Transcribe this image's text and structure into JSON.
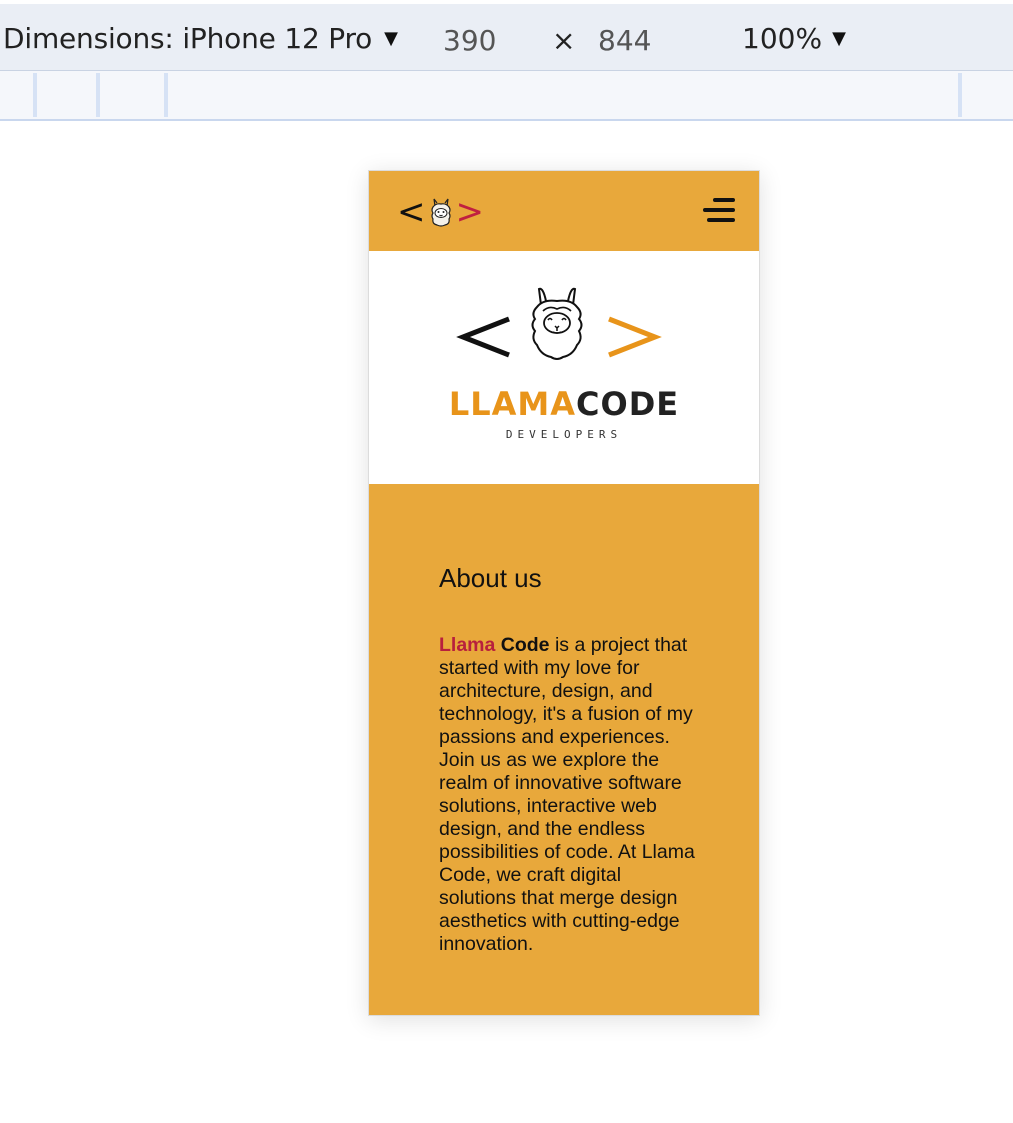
{
  "devtools": {
    "dimensions_label": "Dimensions: iPhone 12 Pro",
    "width": "390",
    "times": "×",
    "height": "844",
    "zoom": "100%"
  },
  "navbar": {
    "logo_left": "<",
    "logo_right": ">",
    "menu_icon": "hamburger-icon"
  },
  "hero": {
    "brand_part1": "LLAMA",
    "brand_part2": "CODE",
    "tagline": "DEVELOPERS",
    "icon": "llama-icon"
  },
  "about": {
    "heading": "About us",
    "name_part1": "Llama",
    "name_part2": "Code",
    "body": " is a project that started with my love for architecture, design, and technology, it's a fusion of my passions and experiences. Join us as we explore the realm of innovative software solutions, interactive web design, and the endless possibilities of code. At Llama Code, we craft digital solutions that merge design aesthetics with cutting-edge innovation."
  },
  "colors": {
    "accent": "#e8a83b",
    "brand_orange": "#e8941a",
    "brand_red": "#b8203d"
  }
}
